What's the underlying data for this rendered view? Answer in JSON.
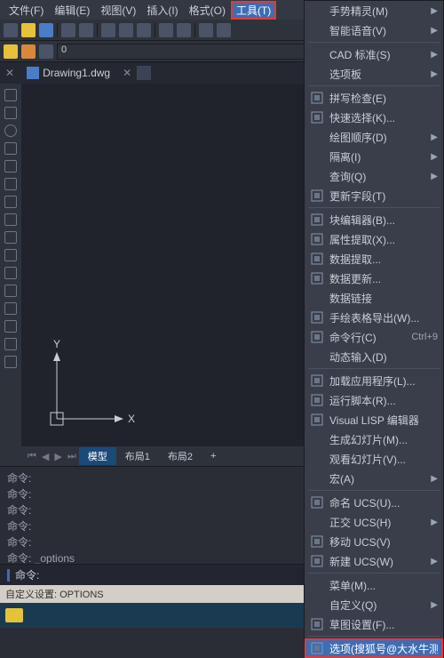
{
  "menubar": {
    "items": [
      "文件(F)",
      "编辑(E)",
      "视图(V)",
      "插入(I)",
      "格式(O)",
      "工具(T)"
    ],
    "activeIndex": 5
  },
  "tabs": {
    "file": "Drawing1.dwg"
  },
  "layout": {
    "model": "模型",
    "l1": "布局1",
    "l2": "布局2"
  },
  "cmd": {
    "p": "命令:",
    "opt": "命令: _options",
    "input": "命令:"
  },
  "status": {
    "text": "自定义设置: OPTIONS"
  },
  "ucs": {
    "x": "X",
    "y": "Y"
  },
  "dropdown": [
    {
      "label": "手势精灵(M)",
      "arrow": true
    },
    {
      "label": "智能语音(V)",
      "arrow": true
    },
    {
      "sep": true
    },
    {
      "label": "CAD 标准(S)",
      "arrow": true
    },
    {
      "label": "选项板",
      "arrow": true
    },
    {
      "sep": true
    },
    {
      "icon": "abc",
      "label": "拼写检查(E)"
    },
    {
      "icon": "qsel",
      "label": "快速选择(K)..."
    },
    {
      "label": "绘图顺序(D)",
      "arrow": true
    },
    {
      "label": "隔离(I)",
      "arrow": true
    },
    {
      "label": "查询(Q)",
      "arrow": true
    },
    {
      "icon": "upd",
      "label": "更新字段(T)"
    },
    {
      "sep": true
    },
    {
      "icon": "blk",
      "label": "块编辑器(B)..."
    },
    {
      "icon": "attr",
      "label": "属性提取(X)..."
    },
    {
      "icon": "dext",
      "label": "数据提取..."
    },
    {
      "icon": "dupd",
      "label": "数据更新..."
    },
    {
      "label": "数据链接"
    },
    {
      "icon": "tbl",
      "label": "手绘表格导出(W)..."
    },
    {
      "icon": "cli",
      "label": "命令行(C)",
      "shortcut": "Ctrl+9"
    },
    {
      "label": "动态输入(D)"
    },
    {
      "sep": true
    },
    {
      "icon": "app",
      "label": "加载应用程序(L)..."
    },
    {
      "icon": "scr",
      "label": "运行脚本(R)..."
    },
    {
      "icon": "lsp",
      "label": "Visual LISP 编辑器"
    },
    {
      "label": "生成幻灯片(M)..."
    },
    {
      "label": "观看幻灯片(V)..."
    },
    {
      "label": "宏(A)",
      "arrow": true
    },
    {
      "sep": true
    },
    {
      "icon": "ucs",
      "label": "命名 UCS(U)..."
    },
    {
      "label": "正交 UCS(H)",
      "arrow": true
    },
    {
      "icon": "mucs",
      "label": "移动 UCS(V)"
    },
    {
      "icon": "nucs",
      "label": "新建 UCS(W)",
      "arrow": true
    },
    {
      "sep": true
    },
    {
      "label": "菜单(M)..."
    },
    {
      "label": "自定义(Q)",
      "arrow": true
    },
    {
      "icon": "grid",
      "label": "草图设置(F)..."
    },
    {
      "sep": true
    },
    {
      "icon": "opt",
      "label": "选项(搜狐号@大水牛测绘",
      "highlight": true
    }
  ]
}
